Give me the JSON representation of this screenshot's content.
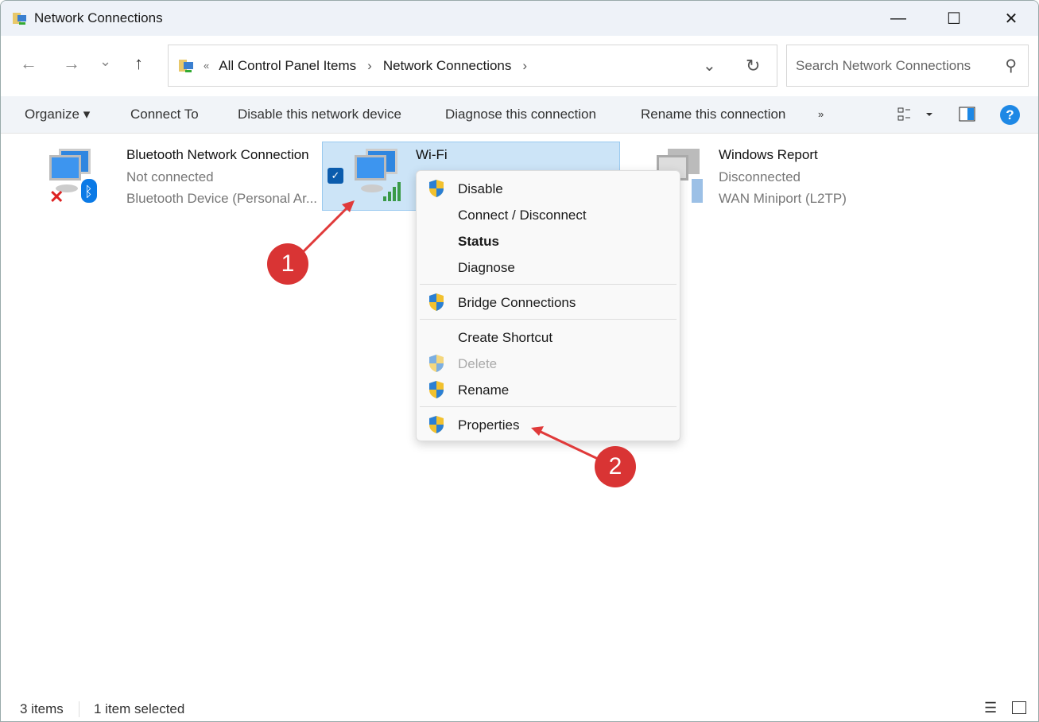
{
  "window": {
    "title": "Network Connections",
    "minimize": "—",
    "maximize": "☐",
    "close": "✕"
  },
  "nav": {
    "back": "←",
    "forward": "→",
    "recent": "⌄",
    "up": "↑",
    "breadcrumb_prefix": "«",
    "breadcrumb": [
      "All Control Panel Items",
      "Network Connections"
    ],
    "sep": "›",
    "dropdown": "⌄",
    "refresh": "↻",
    "search_placeholder": "Search Network Connections",
    "search_icon": "⚲"
  },
  "toolbar": {
    "organize": "Organize ▾",
    "connect_to": "Connect To",
    "disable": "Disable this network device",
    "diagnose": "Diagnose this connection",
    "rename": "Rename this connection",
    "more": "»",
    "help": "?"
  },
  "items": [
    {
      "name": "Bluetooth Network Connection",
      "status": "Not connected",
      "device": "Bluetooth Device (Personal Ar..."
    },
    {
      "name": "Wi-Fi",
      "status": "",
      "device": ""
    },
    {
      "name": "Windows Report",
      "status": "Disconnected",
      "device": "WAN Miniport (L2TP)"
    }
  ],
  "menu": {
    "items": [
      "Disable",
      "Connect / Disconnect",
      "Status",
      "Diagnose",
      "Bridge Connections",
      "Create Shortcut",
      "Delete",
      "Rename",
      "Properties"
    ]
  },
  "statusbar": {
    "count": "3 items",
    "selected": "1 item selected"
  },
  "annotations": {
    "one": "1",
    "two": "2"
  },
  "colors": {
    "accent": "#0067c0",
    "annotation": "#d93434"
  }
}
